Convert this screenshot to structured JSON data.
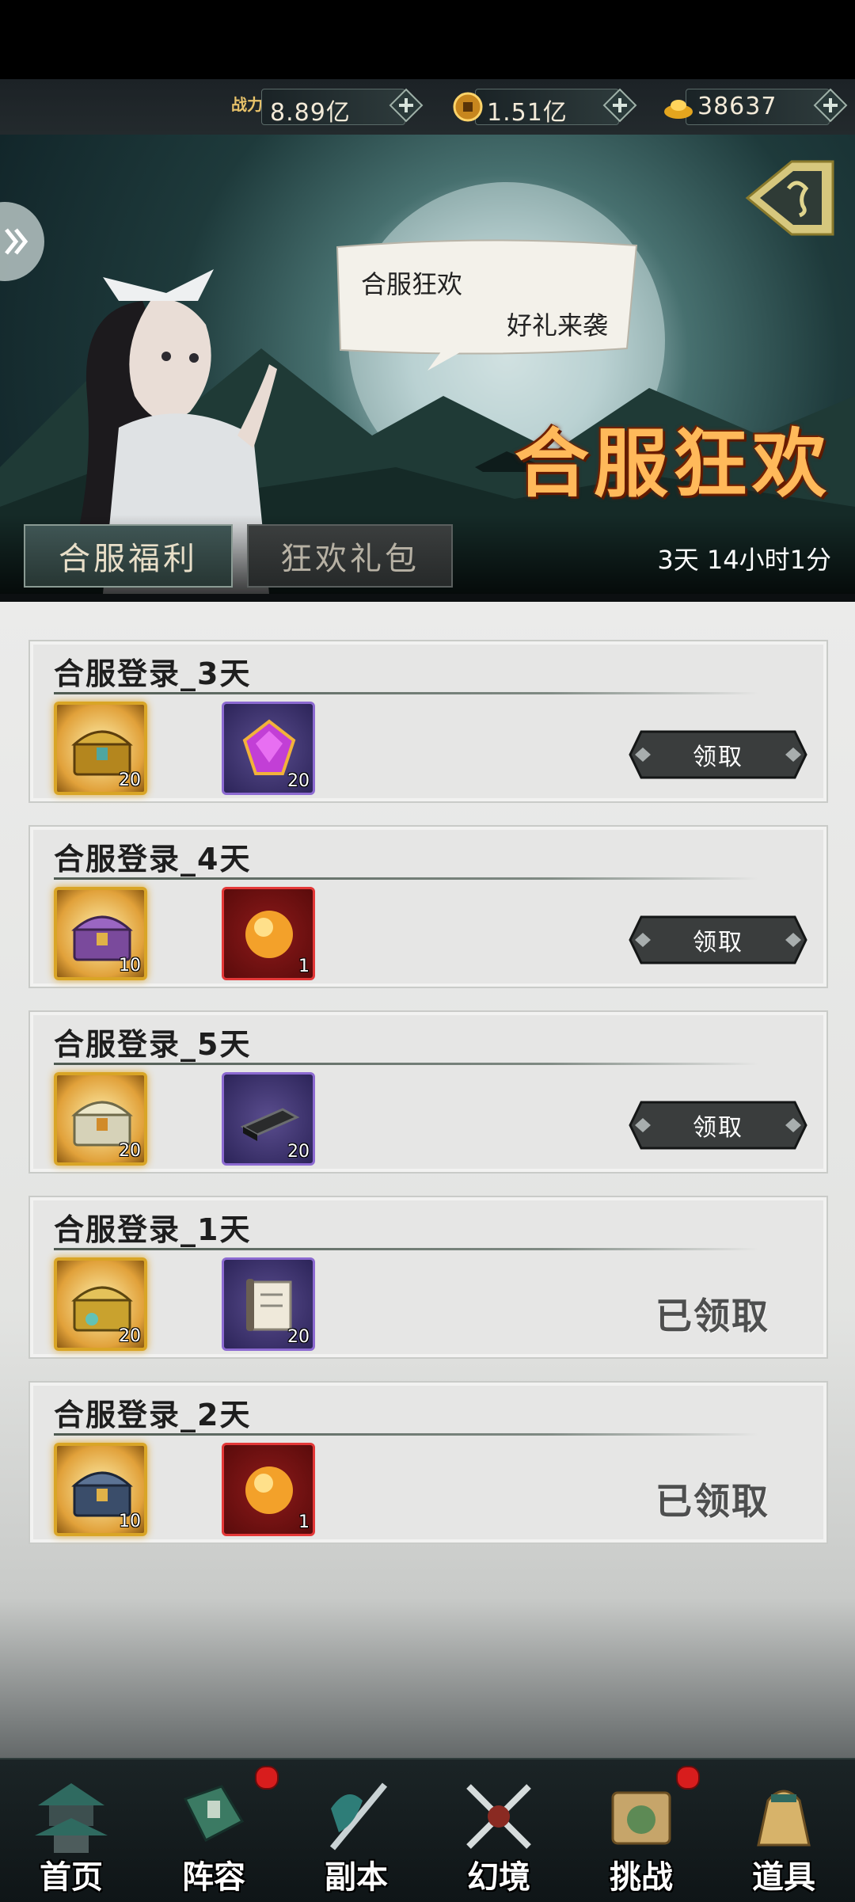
{
  "resources": {
    "power_label": "战力",
    "power_value": "8.89亿",
    "coins_value": "1.51亿",
    "ingots_value": "38637"
  },
  "banner": {
    "bubble_line1": "合服狂欢",
    "bubble_line2": "好礼来袭",
    "title": "合服狂欢"
  },
  "tabs": {
    "active": "合服福利",
    "inactive": "狂欢礼包",
    "timer": "3天 14小时1分"
  },
  "rewards": [
    {
      "title": "合服登录_3天",
      "item1_qty": "20",
      "item2_qty": "20",
      "item2_type": "purple-gem",
      "status": "领取"
    },
    {
      "title": "合服登录_4天",
      "item1_qty": "10",
      "item2_qty": "1",
      "item2_type": "orange-orb",
      "status": "领取"
    },
    {
      "title": "合服登录_5天",
      "item1_qty": "20",
      "item2_qty": "20",
      "item2_type": "dark-bar",
      "status": "领取"
    },
    {
      "title": "合服登录_1天",
      "item1_qty": "20",
      "item2_qty": "20",
      "item2_type": "scroll",
      "status": "已领取"
    },
    {
      "title": "合服登录_2天",
      "item1_qty": "10",
      "item2_qty": "1",
      "item2_type": "orange-orb",
      "status": "已领取"
    }
  ],
  "nav": [
    {
      "label": "首页",
      "badge": false
    },
    {
      "label": "阵容",
      "badge": true
    },
    {
      "label": "副本",
      "badge": false
    },
    {
      "label": "幻境",
      "badge": false
    },
    {
      "label": "挑战",
      "badge": true
    },
    {
      "label": "道具",
      "badge": false
    }
  ],
  "colors": {
    "accent_gold": "#d9a526",
    "badge_red": "#d81d1d",
    "title_orange": "#ffb95a"
  }
}
